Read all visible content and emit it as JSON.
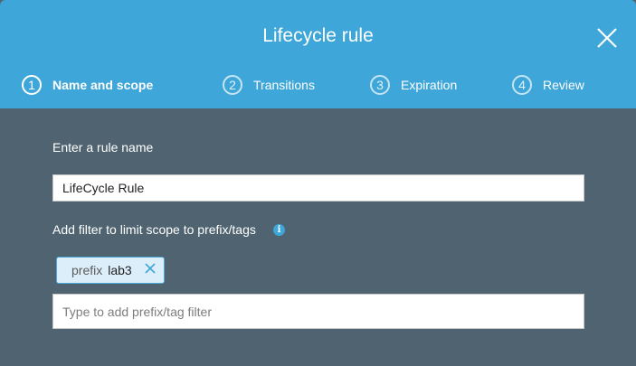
{
  "dialog": {
    "title": "Lifecycle rule"
  },
  "steps": [
    {
      "number": "1",
      "label": "Name and scope",
      "active": true
    },
    {
      "number": "2",
      "label": "Transitions",
      "active": false
    },
    {
      "number": "3",
      "label": "Expiration",
      "active": false
    },
    {
      "number": "4",
      "label": "Review",
      "active": false
    }
  ],
  "form": {
    "rule_name_label": "Enter a rule name",
    "rule_name_value": "LifeCycle Rule",
    "filter_label": "Add filter to limit scope to prefix/tags",
    "filter_info_icon": "info-icon",
    "filters": [
      {
        "key": "prefix",
        "value": "lab3"
      }
    ],
    "filter_placeholder": "Type to add prefix/tag filter"
  },
  "colors": {
    "header": "#3ea6d9",
    "body": "#4f6470",
    "chip_border": "#4aa8d8",
    "chip_bg": "#dceefa"
  }
}
